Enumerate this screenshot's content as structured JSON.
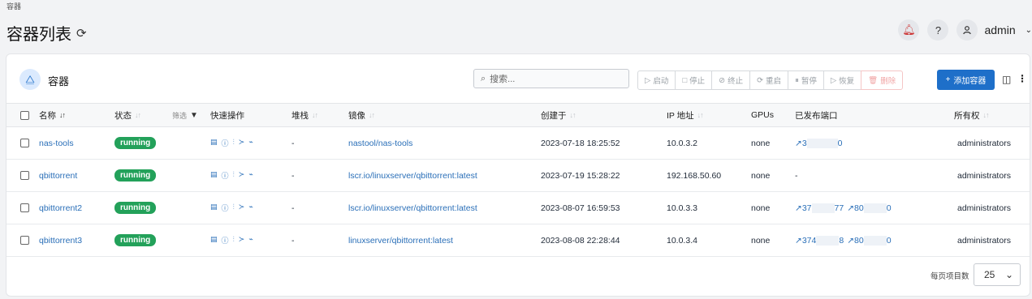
{
  "breadcrumb": "容器",
  "page": {
    "title": "容器列表"
  },
  "user": {
    "name": "admin"
  },
  "card": {
    "title": "容器",
    "search_placeholder": "搜索...",
    "actions": [
      "启动",
      "停止",
      "终止",
      "重启",
      "暂停",
      "恢复",
      "删除"
    ],
    "add_label": "添加容器"
  },
  "table": {
    "columns": [
      "名称",
      "状态",
      "快速操作",
      "堆栈",
      "镜像",
      "创建于",
      "IP 地址",
      "GPUs",
      "已发布端口",
      "所有权"
    ],
    "filter_label": "筛选",
    "rows": [
      {
        "name": "nas-tools",
        "status": "running",
        "stack": "-",
        "image": "nastool/nas-tools",
        "created": "2023-07-18 18:25:52",
        "ip": "10.0.3.2",
        "gpus": "none",
        "ports": [
          {
            "pre": "3",
            "post": "0"
          }
        ],
        "ownership": "administrators"
      },
      {
        "name": "qbittorrent",
        "status": "running",
        "stack": "-",
        "image": "lscr.io/linuxserver/qbittorrent:latest",
        "created": "2023-07-19 15:28:22",
        "ip": "192.168.50.60",
        "gpus": "none",
        "ports_text": "-",
        "ownership": "administrators"
      },
      {
        "name": "qbittorrent2",
        "status": "running",
        "stack": "-",
        "image": "lscr.io/linuxserver/qbittorrent:latest",
        "created": "2023-08-07 16:59:53",
        "ip": "10.0.3.3",
        "gpus": "none",
        "ports": [
          {
            "pre": "37",
            "post": "77"
          },
          {
            "pre": "80",
            "post": "0"
          }
        ],
        "ownership": "administrators"
      },
      {
        "name": "qbittorrent3",
        "status": "running",
        "stack": "-",
        "image": "linuxserver/qbittorrent:latest",
        "created": "2023-08-08 22:28:44",
        "ip": "10.0.3.4",
        "gpus": "none",
        "ports": [
          {
            "pre": "374",
            "post": "8"
          },
          {
            "pre": "80",
            "post": "0"
          }
        ],
        "ownership": "administrators"
      }
    ]
  },
  "pagination": {
    "per_page_label": "每页项目数",
    "per_page": "25"
  }
}
